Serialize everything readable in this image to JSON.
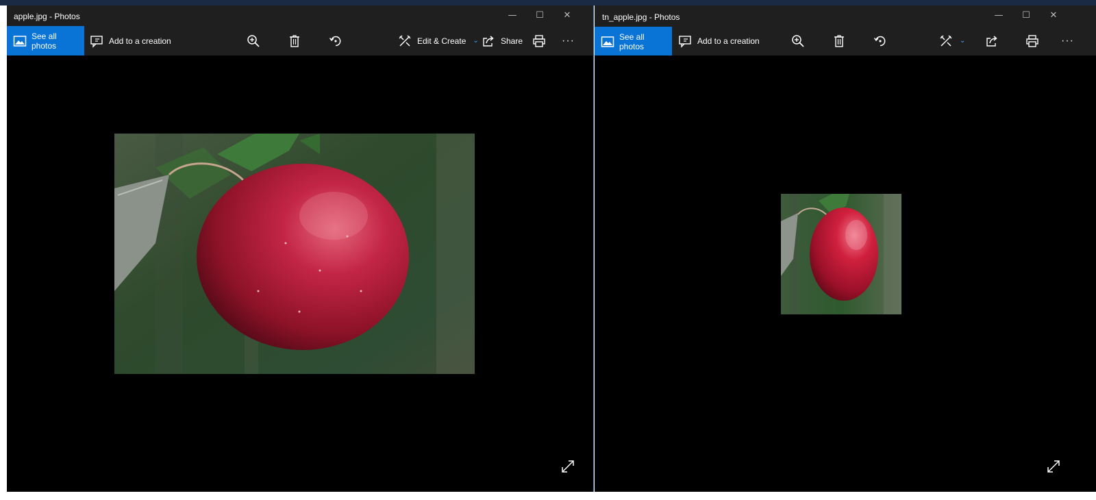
{
  "left_window": {
    "title": "apple.jpg - Photos",
    "toolbar": {
      "see_all": "See all photos",
      "add_to_creation": "Add to a creation",
      "edit_create": "Edit & Create",
      "share": "Share",
      "more": "···"
    },
    "photo": {
      "subject": "red apple on branch",
      "icon": "photo-image"
    }
  },
  "right_window": {
    "title": "tn_apple.jpg - Photos",
    "toolbar": {
      "see_all": "See all photos",
      "add_to_creation": "Add to a creation",
      "more": "···"
    },
    "photo": {
      "subject": "red apple thumbnail",
      "icon": "photo-image"
    }
  },
  "caption": {
    "minimize": "—",
    "maximize": "☐",
    "close": "✕"
  },
  "colors": {
    "accent": "#0a74d6",
    "titlebar": "#1f1f1f",
    "stage": "#000000",
    "link_chevron": "#4aa3ff"
  }
}
